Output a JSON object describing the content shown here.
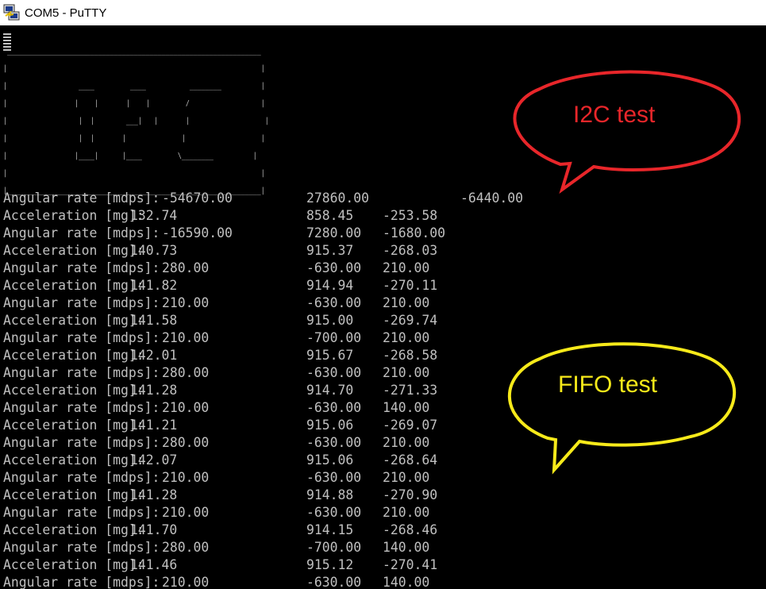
{
  "window": {
    "title": "COM5 - PuTTY",
    "icon": "putty-icon"
  },
  "banner": {
    "text": " ________________________________________________________________\n|                                                                |\n|                  ____         ____           ________          |\n|                 |    |       |    |         /                  |\n|                  |  |        ___|   |       |                   |\n|                  |  |       |              |                   |\n|                 |____|      |____         \\________          |\n|                                                                |\n|________________________________________________________________|"
  },
  "output_lines": [
    {
      "label": "Angular rate [mdps]:",
      "v1": "-54670.00",
      "v2": "27860.00",
      "v3": "-6440.00"
    },
    {
      "label": "Acceleration [mg]:",
      "v1": "132.74",
      "v2": "858.45",
      "v3": "-253.58"
    },
    {
      "label": "Angular rate [mdps]:",
      "v1": "-16590.00",
      "v2": "7280.00",
      "v3": "-1680.00"
    },
    {
      "label": "Acceleration [mg]:",
      "v1": "140.73",
      "v2": "915.37",
      "v3": "-268.03"
    },
    {
      "label": "Angular rate [mdps]:",
      "v1": "280.00",
      "v2": "-630.00",
      "v3": "210.00"
    },
    {
      "label": "Acceleration [mg]:",
      "v1": "141.82",
      "v2": "914.94",
      "v3": "-270.11"
    },
    {
      "label": "Angular rate [mdps]:",
      "v1": "210.00",
      "v2": "-630.00",
      "v3": "210.00"
    },
    {
      "label": "Acceleration [mg]:",
      "v1": "141.58",
      "v2": "915.00",
      "v3": "-269.74"
    },
    {
      "label": "Angular rate [mdps]:",
      "v1": "210.00",
      "v2": "-700.00",
      "v3": "210.00"
    },
    {
      "label": "Acceleration [mg]:",
      "v1": "142.01",
      "v2": "915.67",
      "v3": "-268.58"
    },
    {
      "label": "Angular rate [mdps]:",
      "v1": "280.00",
      "v2": "-630.00",
      "v3": "210.00"
    },
    {
      "label": "Acceleration [mg]:",
      "v1": "141.28",
      "v2": "914.70",
      "v3": "-271.33"
    },
    {
      "label": "Angular rate [mdps]:",
      "v1": "210.00",
      "v2": "-630.00",
      "v3": "140.00"
    },
    {
      "label": "Acceleration [mg]:",
      "v1": "141.21",
      "v2": "915.06",
      "v3": "-269.07"
    },
    {
      "label": "Angular rate [mdps]:",
      "v1": "280.00",
      "v2": "-630.00",
      "v3": "210.00"
    },
    {
      "label": "Acceleration [mg]:",
      "v1": "142.07",
      "v2": "915.06",
      "v3": "-268.64"
    },
    {
      "label": "Angular rate [mdps]:",
      "v1": "210.00",
      "v2": "-630.00",
      "v3": "210.00"
    },
    {
      "label": "Acceleration [mg]:",
      "v1": "141.28",
      "v2": "914.88",
      "v3": "-270.90"
    },
    {
      "label": "Angular rate [mdps]:",
      "v1": "210.00",
      "v2": "-630.00",
      "v3": "210.00"
    },
    {
      "label": "Acceleration [mg]:",
      "v1": "141.70",
      "v2": "914.15",
      "v3": "-268.46"
    },
    {
      "label": "Angular rate [mdps]:",
      "v1": "280.00",
      "v2": "-700.00",
      "v3": "140.00"
    },
    {
      "label": "Acceleration [mg]:",
      "v1": "141.46",
      "v2": "915.12",
      "v3": "-270.41"
    },
    {
      "label": "Angular rate [mdps]:",
      "v1": "210.00",
      "v2": "-630.00",
      "v3": "140.00"
    }
  ],
  "annotations": {
    "i2c": {
      "text": "I2C test",
      "color": "#e8262a"
    },
    "fifo": {
      "text": "FIFO test",
      "color": "#f7ea1a"
    }
  },
  "colors": {
    "terminal_bg": "#000000",
    "terminal_text": "#c0c0c0"
  }
}
